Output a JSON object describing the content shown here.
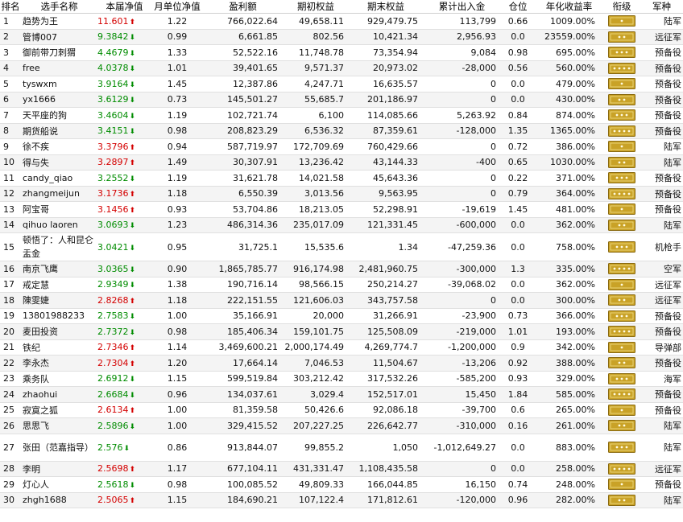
{
  "headers": [
    "排名",
    "选手名称",
    "本届净值",
    "月单位净值",
    "盈利额",
    "期初权益",
    "期末权益",
    "累计出入金",
    "仓位",
    "年化收益率",
    "衔级",
    "军种"
  ],
  "colors": {
    "up": "#d40000",
    "down": "#008c00",
    "badge_gold": "#c9a227",
    "badge_dark": "#8a6a10"
  },
  "rows": [
    {
      "rank": "1",
      "name": "趋势为王",
      "nav": "11.601",
      "dir": "up",
      "month": "1.22",
      "profit": "766,022.64",
      "begin": "49,658.11",
      "end": "929,479.75",
      "flow": "113,799",
      "pos": "0.66",
      "rate": "1009.00%",
      "badge": "rank-badge-1",
      "arm": "陆军"
    },
    {
      "rank": "2",
      "name": "管博007",
      "nav": "9.3842",
      "dir": "down",
      "month": "0.99",
      "profit": "6,661.85",
      "begin": "802.56",
      "end": "10,421.34",
      "flow": "2,956.93",
      "pos": "0.0",
      "rate": "23559.00%",
      "badge": "rank-badge-2",
      "arm": "远征军"
    },
    {
      "rank": "3",
      "name": "御前带刀刺猬",
      "nav": "4.4679",
      "dir": "down",
      "month": "1.33",
      "profit": "52,522.16",
      "begin": "11,748.78",
      "end": "73,354.94",
      "flow": "9,084",
      "pos": "0.98",
      "rate": "695.00%",
      "badge": "rank-badge-3",
      "arm": "预备役"
    },
    {
      "rank": "4",
      "name": "free",
      "nav": "4.0378",
      "dir": "down",
      "month": "1.01",
      "profit": "39,401.65",
      "begin": "9,571.37",
      "end": "20,973.02",
      "flow": "-28,000",
      "pos": "0.56",
      "rate": "560.00%",
      "badge": "rank-badge-4",
      "arm": "预备役"
    },
    {
      "rank": "5",
      "name": "tyswxm",
      "nav": "3.9164",
      "dir": "down",
      "month": "1.45",
      "profit": "12,387.86",
      "begin": "4,247.71",
      "end": "16,635.57",
      "flow": "0",
      "pos": "0.0",
      "rate": "479.00%",
      "badge": "rank-badge-5",
      "arm": "预备役"
    },
    {
      "rank": "6",
      "name": "yx1666",
      "nav": "3.6129",
      "dir": "down",
      "month": "0.73",
      "profit": "145,501.27",
      "begin": "55,685.7",
      "end": "201,186.97",
      "flow": "0",
      "pos": "0.0",
      "rate": "430.00%",
      "badge": "rank-badge-6",
      "arm": "预备役"
    },
    {
      "rank": "7",
      "name": "天平座的狗",
      "nav": "3.4604",
      "dir": "down",
      "month": "1.19",
      "profit": "102,721.74",
      "begin": "6,100",
      "end": "114,085.66",
      "flow": "5,263.92",
      "pos": "0.84",
      "rate": "874.00%",
      "badge": "rank-badge-7",
      "arm": "预备役"
    },
    {
      "rank": "8",
      "name": "期货船说",
      "nav": "3.4151",
      "dir": "down",
      "month": "0.98",
      "profit": "208,823.29",
      "begin": "6,536.32",
      "end": "87,359.61",
      "flow": "-128,000",
      "pos": "1.35",
      "rate": "1365.00%",
      "badge": "rank-badge-8",
      "arm": "预备役"
    },
    {
      "rank": "9",
      "name": "徐不疾",
      "nav": "3.3796",
      "dir": "up",
      "month": "0.94",
      "profit": "587,719.97",
      "begin": "172,709.69",
      "end": "760,429.66",
      "flow": "0",
      "pos": "0.72",
      "rate": "386.00%",
      "badge": "rank-badge-9",
      "arm": "陆军"
    },
    {
      "rank": "10",
      "name": "得与失",
      "nav": "3.2897",
      "dir": "up",
      "month": "1.49",
      "profit": "30,307.91",
      "begin": "13,236.42",
      "end": "43,144.33",
      "flow": "-400",
      "pos": "0.65",
      "rate": "1030.00%",
      "badge": "rank-badge-10",
      "arm": "陆军"
    },
    {
      "rank": "11",
      "name": "candy_qiao",
      "nav": "3.2552",
      "dir": "down",
      "month": "1.19",
      "profit": "31,621.78",
      "begin": "14,021.58",
      "end": "45,643.36",
      "flow": "0",
      "pos": "0.22",
      "rate": "371.00%",
      "badge": "rank-badge-11",
      "arm": "预备役"
    },
    {
      "rank": "12",
      "name": "zhangmeijun",
      "nav": "3.1736",
      "dir": "up",
      "month": "1.18",
      "profit": "6,550.39",
      "begin": "3,013.56",
      "end": "9,563.95",
      "flow": "0",
      "pos": "0.79",
      "rate": "364.00%",
      "badge": "rank-badge-12",
      "arm": "预备役"
    },
    {
      "rank": "13",
      "name": "阿宝哥",
      "nav": "3.1456",
      "dir": "up",
      "month": "0.93",
      "profit": "53,704.86",
      "begin": "18,213.05",
      "end": "52,298.91",
      "flow": "-19,619",
      "pos": "1.45",
      "rate": "481.00%",
      "badge": "rank-badge-13",
      "arm": "预备役"
    },
    {
      "rank": "14",
      "name": "qihuo laoren",
      "nav": "3.0693",
      "dir": "down",
      "month": "1.23",
      "profit": "486,314.36",
      "begin": "235,017.09",
      "end": "121,331.45",
      "flow": "-600,000",
      "pos": "0.0",
      "rate": "362.00%",
      "badge": "rank-badge-14",
      "arm": "陆军"
    },
    {
      "rank": "15",
      "name": "顿悟了：人和昆仑盂金",
      "nav": "3.0421",
      "dir": "down",
      "month": "0.95",
      "profit": "31,725.1",
      "begin": "15,535.6",
      "end": "1.34",
      "flow": "-47,259.36",
      "pos": "0.0",
      "rate": "758.00%",
      "badge": "rank-badge-15",
      "arm": "机枪手",
      "tall": true
    },
    {
      "rank": "16",
      "name": "南京飞鹰",
      "nav": "3.0365",
      "dir": "down",
      "month": "0.90",
      "profit": "1,865,785.77",
      "begin": "916,174.98",
      "end": "2,481,960.75",
      "flow": "-300,000",
      "pos": "1.3",
      "rate": "335.00%",
      "badge": "rank-badge-16",
      "arm": "空军"
    },
    {
      "rank": "17",
      "name": "戒定慧",
      "nav": "2.9349",
      "dir": "down",
      "month": "1.38",
      "profit": "190,716.14",
      "begin": "98,566.15",
      "end": "250,214.27",
      "flow": "-39,068.02",
      "pos": "0.0",
      "rate": "362.00%",
      "badge": "rank-badge-17",
      "arm": "远征军"
    },
    {
      "rank": "18",
      "name": "陳雯婕",
      "nav": "2.8268",
      "dir": "up",
      "month": "1.18",
      "profit": "222,151.55",
      "begin": "121,606.03",
      "end": "343,757.58",
      "flow": "0",
      "pos": "0.0",
      "rate": "300.00%",
      "badge": "rank-badge-18",
      "arm": "远征军"
    },
    {
      "rank": "19",
      "name": "13801988233",
      "nav": "2.7583",
      "dir": "down",
      "month": "1.00",
      "profit": "35,166.91",
      "begin": "20,000",
      "end": "31,266.91",
      "flow": "-23,900",
      "pos": "0.73",
      "rate": "366.00%",
      "badge": "rank-badge-19",
      "arm": "预备役"
    },
    {
      "rank": "20",
      "name": "麦田投资",
      "nav": "2.7372",
      "dir": "down",
      "month": "0.98",
      "profit": "185,406.34",
      "begin": "159,101.75",
      "end": "125,508.09",
      "flow": "-219,000",
      "pos": "1.01",
      "rate": "193.00%",
      "badge": "rank-badge-20",
      "arm": "预备役"
    },
    {
      "rank": "21",
      "name": "铁纪",
      "nav": "2.7346",
      "dir": "up",
      "month": "1.14",
      "profit": "3,469,600.21",
      "begin": "2,000,174.49",
      "end": "4,269,774.7",
      "flow": "-1,200,000",
      "pos": "0.9",
      "rate": "342.00%",
      "badge": "rank-badge-21",
      "arm": "导弹部"
    },
    {
      "rank": "22",
      "name": "李永杰",
      "nav": "2.7304",
      "dir": "up",
      "month": "1.20",
      "profit": "17,664.14",
      "begin": "7,046.53",
      "end": "11,504.67",
      "flow": "-13,206",
      "pos": "0.92",
      "rate": "388.00%",
      "badge": "rank-badge-22",
      "arm": "预备役"
    },
    {
      "rank": "23",
      "name": "乘务队",
      "nav": "2.6912",
      "dir": "down",
      "month": "1.15",
      "profit": "599,519.84",
      "begin": "303,212.42",
      "end": "317,532.26",
      "flow": "-585,200",
      "pos": "0.93",
      "rate": "329.00%",
      "badge": "rank-badge-23",
      "arm": "海军"
    },
    {
      "rank": "24",
      "name": "zhaohui",
      "nav": "2.6684",
      "dir": "down",
      "month": "0.96",
      "profit": "134,037.61",
      "begin": "3,029.4",
      "end": "152,517.01",
      "flow": "15,450",
      "pos": "1.84",
      "rate": "585.00%",
      "badge": "rank-badge-24",
      "arm": "预备役"
    },
    {
      "rank": "25",
      "name": "寂寞之狐",
      "nav": "2.6134",
      "dir": "up",
      "month": "1.00",
      "profit": "81,359.58",
      "begin": "50,426.6",
      "end": "92,086.18",
      "flow": "-39,700",
      "pos": "0.6",
      "rate": "265.00%",
      "badge": "rank-badge-25",
      "arm": "预备役"
    },
    {
      "rank": "26",
      "name": "思思飞",
      "nav": "2.5896",
      "dir": "down",
      "month": "1.00",
      "profit": "329,415.52",
      "begin": "207,227.25",
      "end": "226,642.77",
      "flow": "-310,000",
      "pos": "0.16",
      "rate": "261.00%",
      "badge": "rank-badge-26",
      "arm": "陆军"
    },
    {
      "rank": "27",
      "name": "张田（范嘉指导）",
      "nav": "2.576",
      "dir": "down",
      "month": "0.86",
      "profit": "913,844.07",
      "begin": "99,855.2",
      "end": "1,050",
      "flow": "-1,012,649.27",
      "pos": "0.0",
      "rate": "883.00%",
      "badge": "rank-badge-27",
      "arm": "陆军",
      "tall": true
    },
    {
      "rank": "28",
      "name": "李明",
      "nav": "2.5698",
      "dir": "up",
      "month": "1.17",
      "profit": "677,104.11",
      "begin": "431,331.47",
      "end": "1,108,435.58",
      "flow": "0",
      "pos": "0.0",
      "rate": "258.00%",
      "badge": "rank-badge-28",
      "arm": "远征军"
    },
    {
      "rank": "29",
      "name": "灯心人",
      "nav": "2.5618",
      "dir": "down",
      "month": "0.98",
      "profit": "100,085.52",
      "begin": "49,809.33",
      "end": "166,044.85",
      "flow": "16,150",
      "pos": "0.74",
      "rate": "248.00%",
      "badge": "rank-badge-29",
      "arm": "预备役"
    },
    {
      "rank": "30",
      "name": "zhgh1688",
      "nav": "2.5065",
      "dir": "up",
      "month": "1.15",
      "profit": "184,690.21",
      "begin": "107,122.4",
      "end": "171,812.61",
      "flow": "-120,000",
      "pos": "0.96",
      "rate": "282.00%",
      "badge": "rank-badge-30",
      "arm": "陆军"
    }
  ]
}
